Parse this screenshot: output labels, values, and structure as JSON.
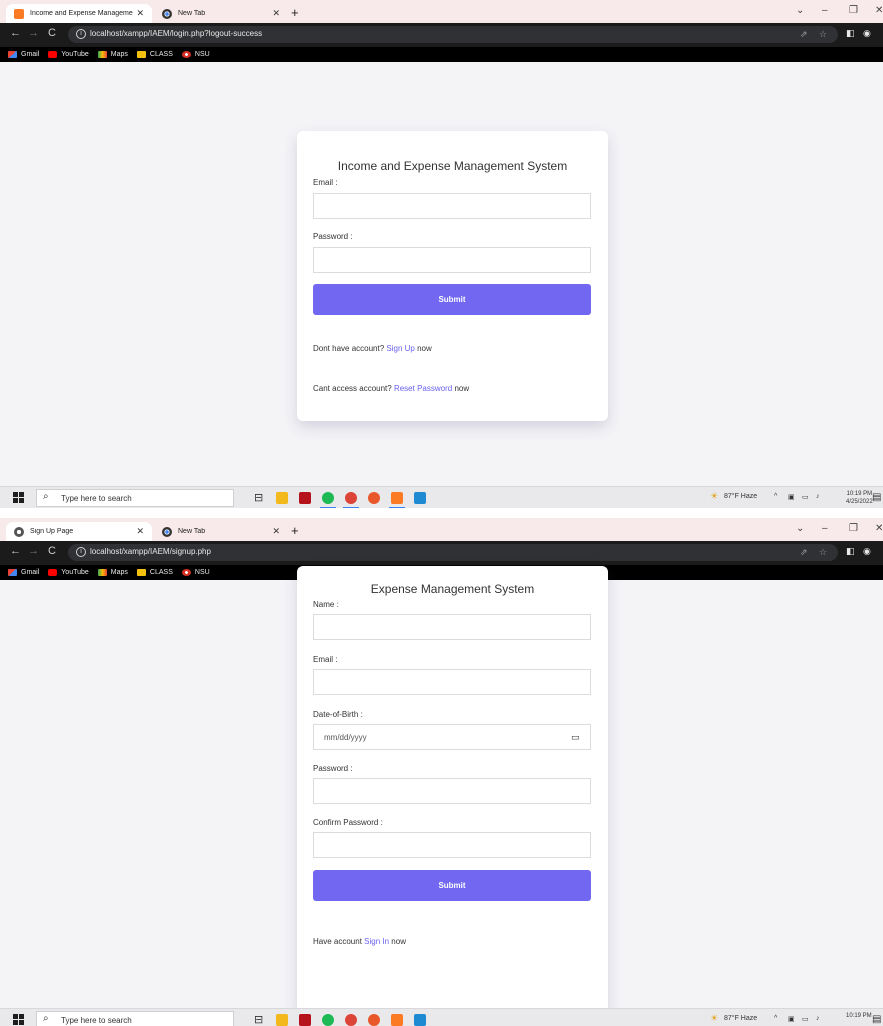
{
  "colors": {
    "accent": "#7167f1",
    "link": "#6a62f0",
    "page_bg": "#f4f4f7",
    "toolbar_bg": "#1b1b1b",
    "tabstrip_bg": "#f8e9ea"
  },
  "shot1": {
    "browser": {
      "tabs": [
        {
          "title": "Income and Expense Manageme",
          "icon": "xampp-icon"
        },
        {
          "title": "New Tab",
          "icon": "chrome-icon"
        }
      ],
      "url": "localhost/xampp/IAEM/login.php?logout-success",
      "bookmarks": [
        "Gmail",
        "YouTube",
        "Maps",
        "CLASS",
        "NSU"
      ]
    },
    "login": {
      "title": "Income and Expense Management System",
      "email_label": "Email :",
      "password_label": "Password :",
      "submit_label": "Submit",
      "signup_prefix": "Dont have account?",
      "signup_link": "Sign Up",
      "signup_suffix": "now",
      "reset_prefix": "Cant access account?",
      "reset_link": "Reset Password",
      "reset_suffix": "now"
    },
    "taskbar": {
      "search_placeholder": "Type here to search",
      "weather": "87°F Haze",
      "time": "10:19 PM",
      "date": "4/25/2022"
    }
  },
  "shot2": {
    "browser": {
      "tabs": [
        {
          "title": "Sign Up Page",
          "icon": "globe-icon"
        },
        {
          "title": "New Tab",
          "icon": "chrome-icon"
        }
      ],
      "url": "localhost/xampp/IAEM/signup.php",
      "bookmarks": [
        "Gmail",
        "YouTube",
        "Maps",
        "CLASS",
        "NSU"
      ]
    },
    "signup": {
      "title": "Expense Management System",
      "name_label": "Name :",
      "email_label": "Email :",
      "dob_label": "Date-of-Birth :",
      "dob_placeholder": "mm/dd/yyyy",
      "password_label": "Password :",
      "confirm_label": "Confirm Password :",
      "submit_label": "Submit",
      "signin_prefix": "Have account",
      "signin_link": "Sign In",
      "signin_suffix": "now"
    },
    "taskbar": {
      "search_placeholder": "Type here to search",
      "weather": "87°F Haze",
      "time": "10:19 PM"
    }
  }
}
